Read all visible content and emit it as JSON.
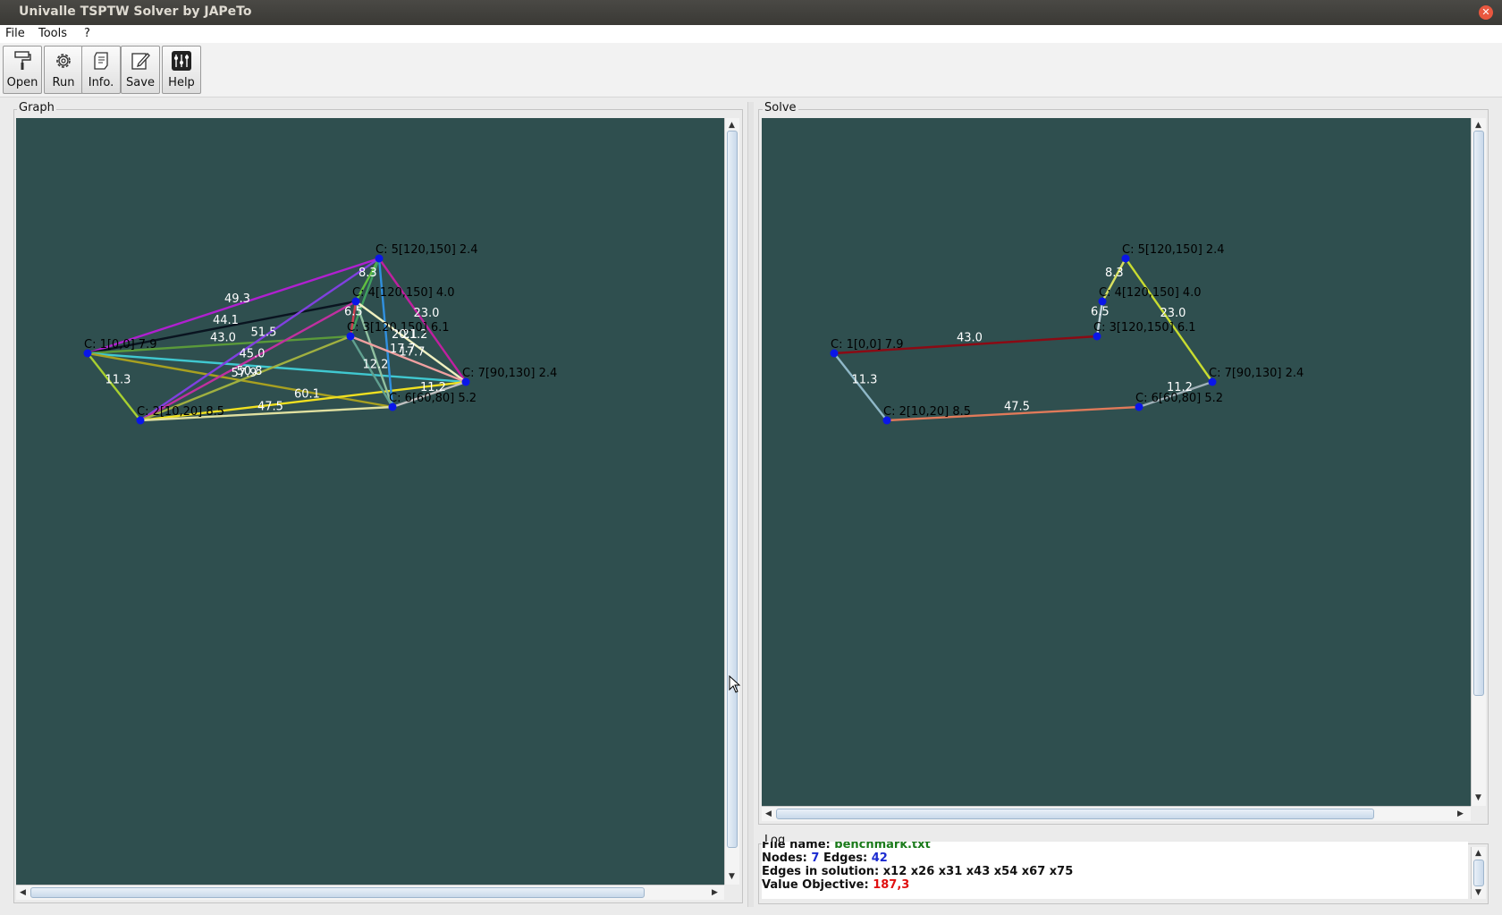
{
  "window": {
    "title": "Univalle TSPTW Solver by JAPeTo"
  },
  "menu": [
    "File",
    "Tools",
    "?"
  ],
  "toolbar": [
    {
      "label": "Open",
      "icon": "paint-roller-icon"
    },
    {
      "label": "Run",
      "icon": "gear-icon"
    },
    {
      "label": "Info.",
      "icon": "scroll-icon"
    },
    {
      "label": "Save",
      "icon": "edit-pencil-icon"
    },
    {
      "label": "Help",
      "icon": "sliders-icon"
    }
  ],
  "panels": {
    "graph": "Graph",
    "solve": "Solve",
    "log": "Log"
  },
  "nodes": [
    {
      "id": 1,
      "label": "C: 1[0,0] 7.9"
    },
    {
      "id": 2,
      "label": "C: 2[10,20] 8.5"
    },
    {
      "id": 3,
      "label": "C: 3[120,150] 6.1"
    },
    {
      "id": 4,
      "label": "C: 4[120,150] 4.0"
    },
    {
      "id": 5,
      "label": "C: 5[120,150] 2.4"
    },
    {
      "id": 6,
      "label": "C: 6[60,80] 5.2"
    },
    {
      "id": 7,
      "label": "C: 7[90,130] 2.4"
    }
  ],
  "graph_edges": [
    {
      "a": 1,
      "b": 5,
      "w": "49.3",
      "color": "#b020d0"
    },
    {
      "a": 1,
      "b": 4,
      "w": "44.1",
      "color": "#0a1420"
    },
    {
      "a": 1,
      "b": 3,
      "w": "43.0",
      "color": "#5a9a3a"
    },
    {
      "a": 1,
      "b": 2,
      "w": "11.3",
      "color": "#a8d030"
    },
    {
      "a": 1,
      "b": 7,
      "w": "",
      "color": "#40c8d0"
    },
    {
      "a": 1,
      "b": 6,
      "w": "57.9",
      "color": "#a8a020"
    },
    {
      "a": 2,
      "b": 5,
      "w": "51.5",
      "color": "#8040e0"
    },
    {
      "a": 2,
      "b": 4,
      "w": "45.0",
      "color": "#c030a0"
    },
    {
      "a": 2,
      "b": 3,
      "w": "50.8",
      "color": "#a0b040"
    },
    {
      "a": 2,
      "b": 7,
      "w": "60.1",
      "color": "#f0e020"
    },
    {
      "a": 2,
      "b": 6,
      "w": "47.5",
      "color": "#e0e0a0"
    },
    {
      "a": 5,
      "b": 4,
      "w": "8.3",
      "color": "#60c040"
    },
    {
      "a": 5,
      "b": 7,
      "w": "23.0",
      "color": "#c020a0"
    },
    {
      "a": 5,
      "b": 6,
      "w": "",
      "color": "#3090e0"
    },
    {
      "a": 5,
      "b": 3,
      "w": "",
      "color": "#40a060"
    },
    {
      "a": 4,
      "b": 3,
      "w": "6.5",
      "color": "#d04050"
    },
    {
      "a": 4,
      "b": 7,
      "w": "21.2",
      "color": "#f0f0c0"
    },
    {
      "a": 4,
      "b": 6,
      "w": "",
      "color": "#90c0a0"
    },
    {
      "a": 3,
      "b": 7,
      "w": "17.7",
      "color": "#f0a0a0"
    },
    {
      "a": 3,
      "b": 6,
      "w": "12.2",
      "color": "#60a090"
    },
    {
      "a": 7,
      "b": 6,
      "w": "11.2",
      "color": "#c0c0c0"
    }
  ],
  "graph_extra_labels": [
    "20.1",
    "17.7"
  ],
  "solution_edges": [
    {
      "a": 1,
      "b": 3,
      "w": "43.0",
      "color": "#8b0a14"
    },
    {
      "a": 1,
      "b": 2,
      "w": "11.3",
      "color": "#8fb8c8"
    },
    {
      "a": 2,
      "b": 6,
      "w": "47.5",
      "color": "#e07a5a"
    },
    {
      "a": 6,
      "b": 7,
      "w": "11.2",
      "color": "#a0b0b8"
    },
    {
      "a": 7,
      "b": 5,
      "w": "23.0",
      "color": "#c8dc30"
    },
    {
      "a": 5,
      "b": 4,
      "w": "8.3",
      "color": "#d8e060"
    },
    {
      "a": 4,
      "b": 3,
      "w": "6.5",
      "color": "#c0d0d8"
    }
  ],
  "log": {
    "file_label": "File name:",
    "file_value": "benchmark.txt",
    "nodes_label": "Nodes:",
    "nodes_value": "7",
    "edges_label": "Edges:",
    "edges_value": "42",
    "solution_label": "Edges in solution:",
    "solution_value": "x12 x26 x31 x43 x54 x67 x75",
    "objective_label": "Value Objective:",
    "objective_value": "187,3"
  },
  "colors": {
    "canvas_bg": "#2f4f4f",
    "node": "#0a16e8",
    "file_value": "#1a7a1a",
    "count_value": "#1a2ad0",
    "objective_value": "#e01010"
  }
}
